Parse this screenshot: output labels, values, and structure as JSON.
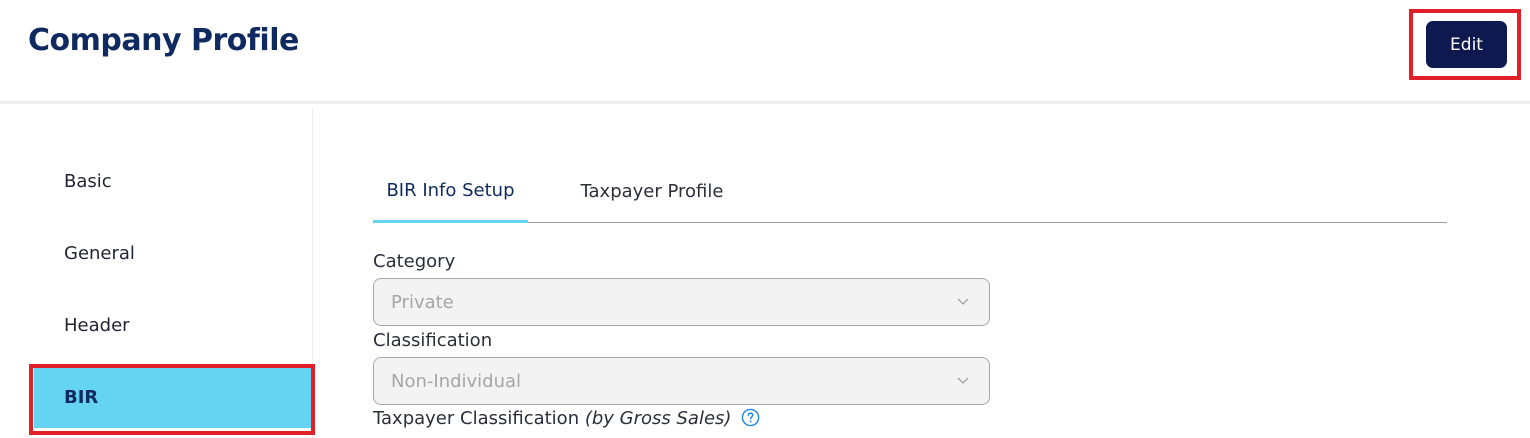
{
  "header": {
    "title": "Company Profile",
    "edit_label": "Edit"
  },
  "sidebar": {
    "items": [
      {
        "label": "Basic",
        "active": false
      },
      {
        "label": "General",
        "active": false
      },
      {
        "label": "Header",
        "active": false
      },
      {
        "label": "BIR",
        "active": true
      }
    ]
  },
  "tabs": [
    {
      "label": "BIR Info Setup",
      "active": true
    },
    {
      "label": "Taxpayer Profile",
      "active": false
    }
  ],
  "form": {
    "category": {
      "label": "Category",
      "value": "Private"
    },
    "classification": {
      "label": "Classification",
      "value": "Non-Individual"
    },
    "taxpayer_classification": {
      "label": "Taxpayer Classification",
      "note": "(by Gross Sales)",
      "icon": "help-circle-icon"
    }
  },
  "colors": {
    "title": "#0f2a5f",
    "edit_button_bg": "#0e1a4f",
    "active_accent": "#65d4f3",
    "highlight": "#e1202a",
    "disabled_field_bg": "#f3f3f3",
    "help_icon": "#1e88e5"
  }
}
